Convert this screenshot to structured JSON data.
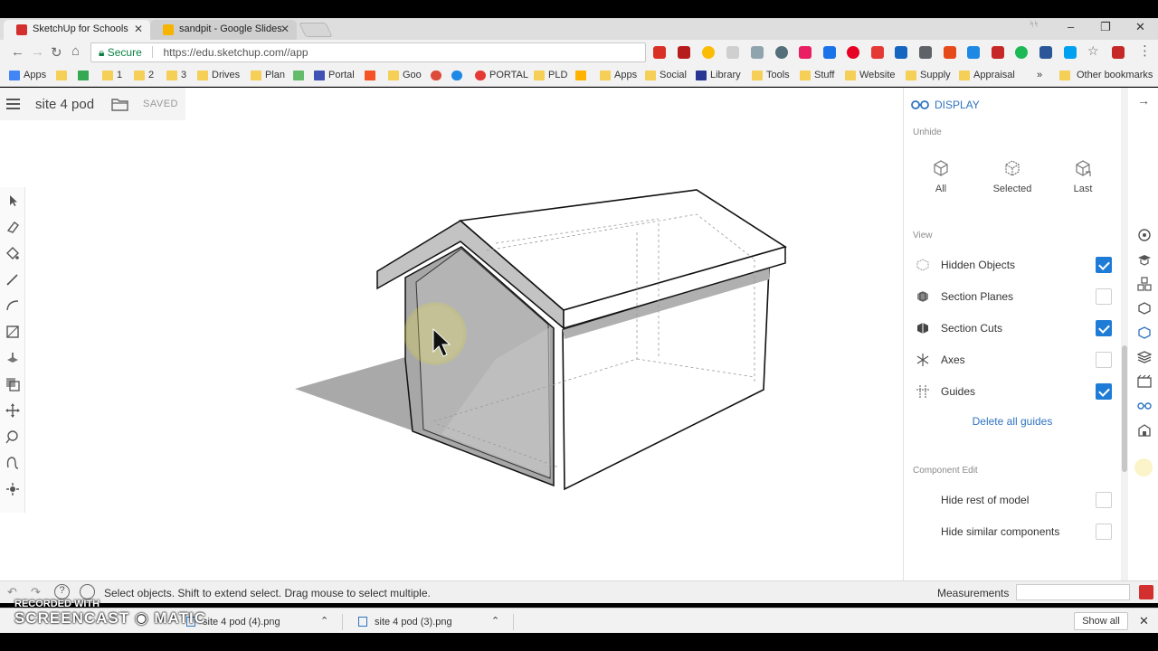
{
  "browser": {
    "tabs": [
      {
        "title": "SketchUp for Schools",
        "icon_color": "#d32f2f",
        "active": true
      },
      {
        "title": "sandpit - Google Slides",
        "icon_color": "#f4b400",
        "active": false
      }
    ],
    "window_controls": {
      "minimize": "–",
      "maximize": "❐",
      "close": "✕"
    },
    "address": {
      "secure_label": "Secure",
      "url": "https://edu.sketchup.com//app"
    },
    "bookmarks": [
      {
        "label": "Apps",
        "icon": "apps-grid-icon",
        "color": "#4285f4"
      },
      {
        "label": "",
        "icon": "folder-icon",
        "color": "#f6cf57"
      },
      {
        "label": "",
        "icon": "drive-icon",
        "color": "#34a853"
      },
      {
        "label": "1",
        "icon": "folder-icon",
        "color": "#f6cf57"
      },
      {
        "label": "2",
        "icon": "folder-icon",
        "color": "#f6cf57"
      },
      {
        "label": "3",
        "icon": "folder-icon",
        "color": "#f6cf57"
      },
      {
        "label": "Drives",
        "icon": "folder-icon",
        "color": "#f6cf57"
      },
      {
        "label": "Plan",
        "icon": "folder-icon",
        "color": "#f6cf57"
      },
      {
        "label": "",
        "icon": "green-flag-icon",
        "color": "#66bb6a"
      },
      {
        "label": "Portal",
        "icon": "portal-icon",
        "color": "#3f51b5"
      },
      {
        "label": "",
        "icon": "windows-icon",
        "color": "#f35325"
      },
      {
        "label": "Goo",
        "icon": "folder-icon",
        "color": "#f6cf57"
      },
      {
        "label": "",
        "icon": "google-plus-icon",
        "color": "#dd4b39"
      },
      {
        "label": "",
        "icon": "edge-icon",
        "color": "#1e88e5"
      },
      {
        "label": "PORTAL",
        "icon": "portal-ring-icon",
        "color": "#e53935"
      },
      {
        "label": "PLD",
        "icon": "folder-icon",
        "color": "#f6cf57"
      },
      {
        "label": "",
        "icon": "star-icon",
        "color": "#ffb300"
      },
      {
        "label": "Apps",
        "icon": "folder-icon",
        "color": "#f6cf57"
      },
      {
        "label": "Social",
        "icon": "folder-icon",
        "color": "#f6cf57"
      },
      {
        "label": "Library",
        "icon": "library-icon",
        "color": "#283593"
      },
      {
        "label": "Tools",
        "icon": "folder-icon",
        "color": "#f6cf57"
      },
      {
        "label": "Stuff",
        "icon": "folder-icon",
        "color": "#f6cf57"
      },
      {
        "label": "Website",
        "icon": "folder-icon",
        "color": "#f6cf57"
      },
      {
        "label": "Supply",
        "icon": "folder-icon",
        "color": "#f6cf57"
      },
      {
        "label": "Appraisal",
        "icon": "folder-icon",
        "color": "#f6cf57"
      }
    ],
    "bookmarks_overflow": "»",
    "other_bookmarks": "Other bookmarks"
  },
  "app": {
    "model_name": "site 4 pod",
    "saved_label": "SAVED",
    "status_message": "Select objects. Shift to extend select. Drag mouse to select multiple.",
    "measurements_label": "Measurements",
    "measurements_value": ""
  },
  "panel": {
    "title": "DISPLAY",
    "unhide_label": "Unhide",
    "unhide_buttons": [
      "All",
      "Selected",
      "Last"
    ],
    "view_label": "View",
    "view_items": [
      {
        "label": "Hidden Objects",
        "checked": true,
        "icon": "hidden-objects-icon"
      },
      {
        "label": "Section Planes",
        "checked": false,
        "icon": "section-planes-icon"
      },
      {
        "label": "Section Cuts",
        "checked": true,
        "icon": "section-cuts-icon"
      },
      {
        "label": "Axes",
        "checked": false,
        "icon": "axes-icon"
      },
      {
        "label": "Guides",
        "checked": true,
        "icon": "guides-icon"
      }
    ],
    "delete_guides": "Delete all guides",
    "component_edit_label": "Component Edit",
    "component_items": [
      {
        "label": "Hide rest of model",
        "checked": false
      },
      {
        "label": "Hide similar components",
        "checked": false
      }
    ]
  },
  "downloads": {
    "items": [
      "site 4 pod (4).png",
      "site 4 pod (3).png"
    ],
    "show_all": "Show all",
    "close": "✕"
  },
  "watermark": {
    "line1": "RECORDED WITH",
    "line2": "SCREENCAST ◉ MATIC"
  },
  "colors": {
    "accent": "#1e7cd6",
    "link": "#2f74c0",
    "cursor_highlight": "#f2ea3c"
  }
}
